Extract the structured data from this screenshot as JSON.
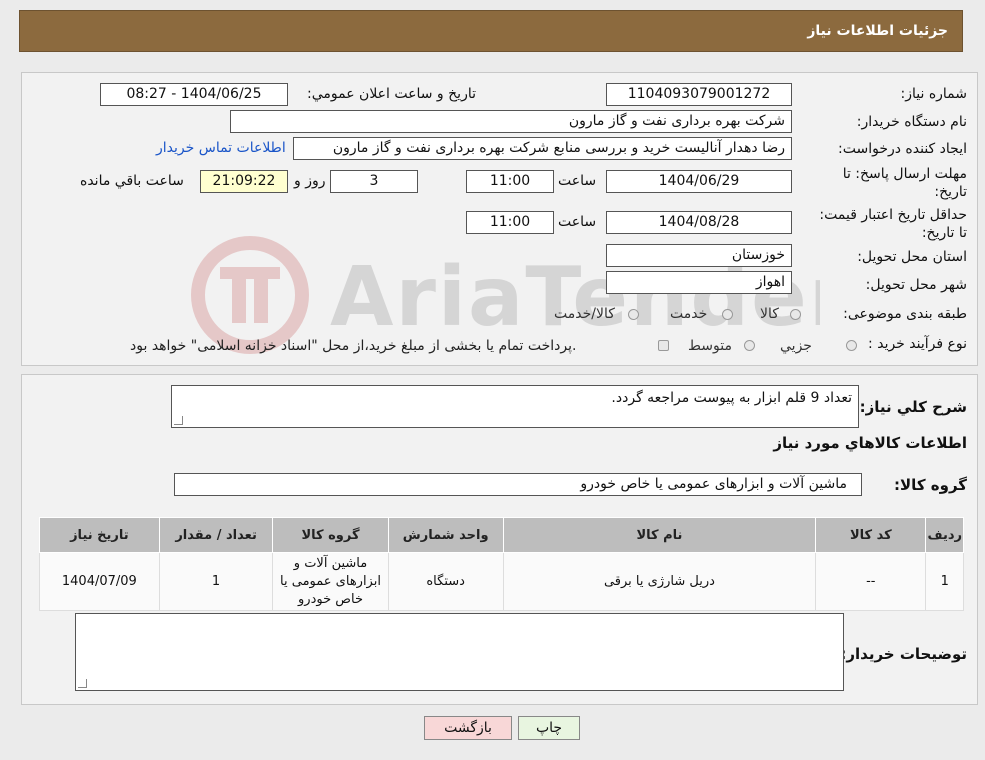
{
  "header": {
    "title": "جزئيات اطلاعات نياز"
  },
  "watermark": {
    "text": "AriaTender.neT"
  },
  "fields": {
    "need_number_label": "شماره نياز:",
    "need_number": "1104093079001272",
    "announce_label": "تاريخ و ساعت اعلان عمومي:",
    "announce_value": "1404/06/25 - 08:27",
    "buyer_org_label": "نام دستگاه خريدار:",
    "buyer_org": "شركت بهره برداری نفت و گاز مارون",
    "creator_label": "ايجاد كننده درخواست:",
    "creator": "رضا دهدار آنالیست خرید و بررسی منابع شرکت بهره برداری نفت و گاز مارون",
    "contact_link": "اطلاعات تماس خريدار",
    "deadline_label": "مهلت ارسال پاسخ: تا تاريخ:",
    "deadline_date": "1404/06/29",
    "time_label": "ساعت",
    "deadline_time": "11:00",
    "days_value": "3",
    "days_label": "روز و",
    "remaining_time": "21:09:22",
    "remaining_label": "ساعت باقي مانده",
    "validity_label": "حداقل تاريخ اعتبار قيمت: تا تاريخ:",
    "validity_date": "1404/08/28",
    "validity_time": "11:00",
    "province_label": "استان محل تحويل:",
    "province": "خوزستان",
    "city_label": "شهر محل تحويل:",
    "city": "اهواز",
    "category_label": "طبقه بندی موضوعی:",
    "category_options": [
      "كالا",
      "خدمت",
      "كالا/خدمت"
    ],
    "process_label": "نوع فرآيند خريد :",
    "process_options": [
      "جزيي",
      "متوسط"
    ],
    "process_note": "پرداخت تمام يا بخشی از مبلغ خريد،از محل \"اسناد خزانه اسلامی\" خواهد بود."
  },
  "description": {
    "label": "شرح كلي نياز:",
    "text": "تعداد 9 قلم ابزار به پیوست مراجعه گردد."
  },
  "goods_info": {
    "title": "اطلاعات كالاهاي مورد نياز",
    "group_label": "گروه كالا:",
    "group_value": "ماشین آلات و ابزارهای عمومی یا خاص خودرو"
  },
  "table": {
    "headers": [
      "رديف",
      "كد كالا",
      "نام كالا",
      "واحد شمارش",
      "گروه كالا",
      "تعداد / مقدار",
      "تاريخ نياز"
    ],
    "rows": [
      [
        "1",
        "--",
        "دریل شارژی یا برقی",
        "دستگاه",
        "ماشین آلات و ابزارهای عمومی یا خاص خودرو",
        "1",
        "1404/07/09"
      ]
    ]
  },
  "buyer_notes": {
    "label": "توضيحات خريدار:"
  },
  "buttons": {
    "print": "چاپ",
    "back": "بازگشت"
  },
  "colors": {
    "header": "#8c6a3e",
    "link": "#1a55c8",
    "back_button": "#f8d7d7",
    "print_button": "#e8f5e0"
  }
}
